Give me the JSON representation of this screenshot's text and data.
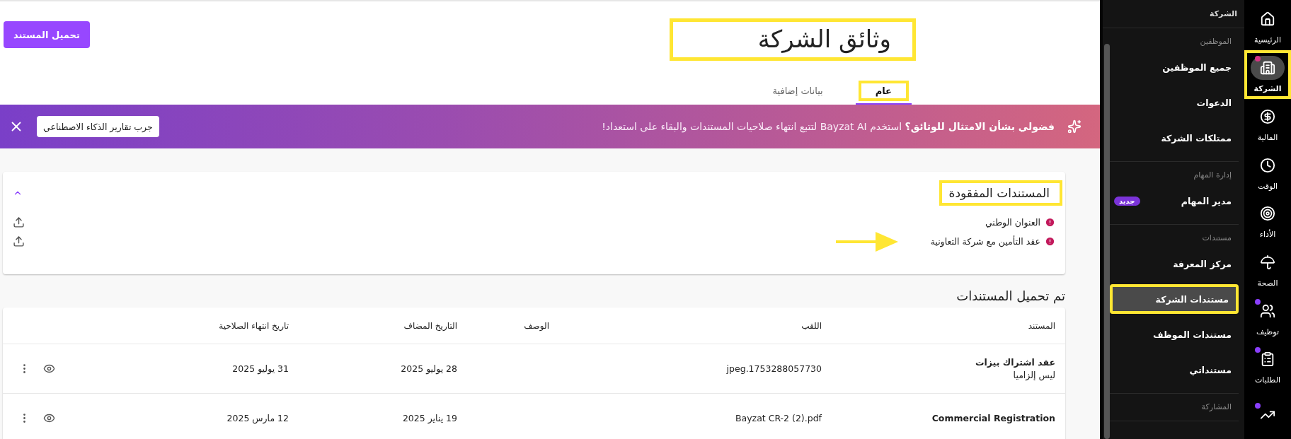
{
  "rail": [
    {
      "label": "الرئيسية",
      "selected": false
    },
    {
      "label": "الشركة",
      "selected": true,
      "highlighted": true,
      "color": "#d63384"
    },
    {
      "label": "المالية",
      "selected": false
    },
    {
      "label": "الوقت",
      "selected": false
    },
    {
      "label": "الأداء",
      "selected": false
    },
    {
      "label": "الصحة",
      "selected": false
    },
    {
      "label": "توظيف",
      "selected": false,
      "color": "#8a3ffc"
    },
    {
      "label": "الطلبات",
      "selected": false,
      "color": "#8a3ffc"
    },
    {
      "selected": false,
      "color": "#8a3ffc"
    }
  ],
  "nav": {
    "title": "الشركة",
    "sections": [
      {
        "title": "الموظفين",
        "items": [
          {
            "label": "جميع الموظفين",
            "selected": false
          },
          {
            "label": "الدعوات",
            "selected": false
          },
          {
            "label": "ممتلكات الشركة",
            "selected": false
          }
        ]
      },
      {
        "title": "إدارة المهام",
        "items": [
          {
            "label": "مدير المهام",
            "selected": false,
            "badge": "جديد"
          }
        ]
      },
      {
        "title": "مستندات",
        "items": [
          {
            "label": "مركز المعرفة",
            "selected": false
          },
          {
            "label": "مستندات الشركة",
            "selected": true,
            "highlighted": true
          },
          {
            "label": "مستندات الموظف",
            "selected": false
          },
          {
            "label": "مستنداتي",
            "selected": false
          }
        ]
      },
      {
        "title": "المشاركة"
      }
    ]
  },
  "header": {
    "title": "وثائق الشركة",
    "highlighted": true,
    "upload_button": "تحميل المستند"
  },
  "tabs": [
    {
      "label": "عام",
      "selected": true,
      "highlighted": true
    },
    {
      "label": "بيانات إضافية",
      "selected": false,
      "highlighted": false
    }
  ],
  "banner": {
    "text": "**فضولي بشأن الامتثال للوثائق؟** استخدم Bayzat AI لتتبع انتهاء صلاحيات المستندات والبقاء على استعداد!",
    "button": "جرب تقارير الذكاء الاصطناعي"
  },
  "missing": {
    "title": "المستندات المفقودة",
    "highlighted": true,
    "expanded": true,
    "items": [
      {
        "label": "العنوان الوطني",
        "arrow": false
      },
      {
        "label": "عقد التأمين مع شركة التعاونية",
        "arrow": true
      }
    ]
  },
  "uploaded": {
    "title": "تم تحميل المستندات",
    "columns": [
      "المستند",
      "اللقب",
      "الوصف",
      "التاريخ المضاف",
      "تاريخ انتهاء الصلاحية"
    ],
    "rows": [
      {
        "document": "عقد اشتراك بيزات",
        "note": "ليس إلزاميا",
        "title": "1753288057730.jpeg",
        "added": "28 يوليو 2025",
        "expires": "31 يوليو 2025"
      },
      {
        "document": "Commercial Registration",
        "title": "Bayzat CR-2 (2).pdf",
        "added": "19 يناير 2025",
        "expires": "12 مارس 2025"
      }
    ]
  }
}
